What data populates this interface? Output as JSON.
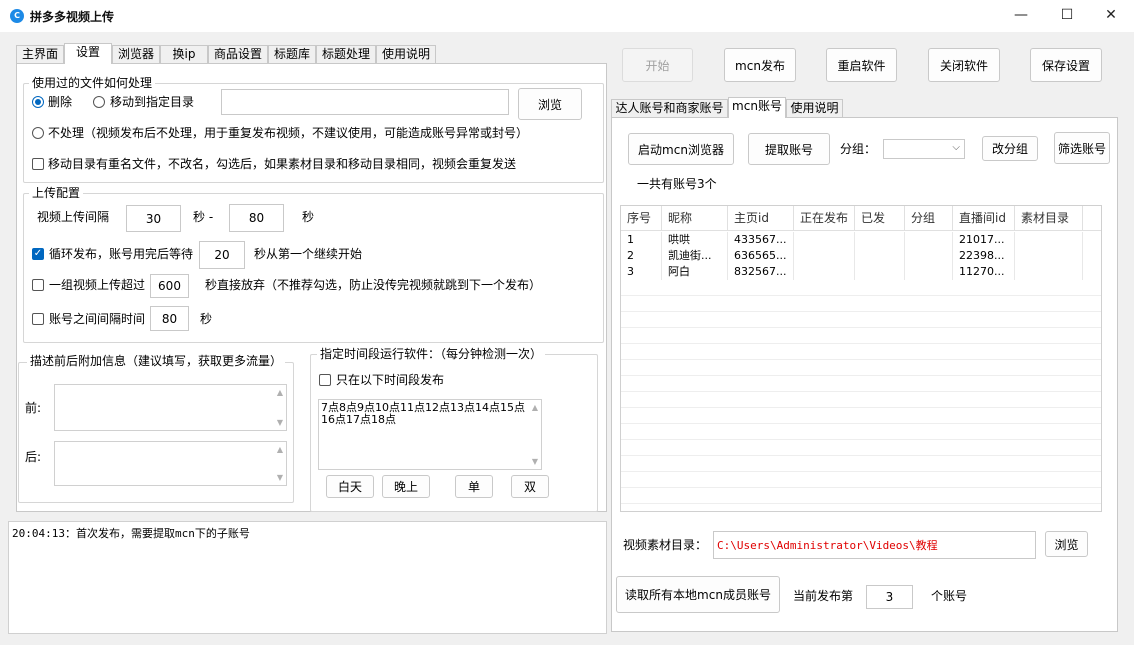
{
  "window": {
    "title": "拼多多视频上传",
    "minimize": "—",
    "maximize": "☐",
    "close": "✕"
  },
  "left_tabs": [
    "主界面",
    "设置",
    "浏览器",
    "换ip",
    "商品设置",
    "标题库",
    "标题处理",
    "使用说明"
  ],
  "file_handling": {
    "legend": "使用过的文件如何处理",
    "delete_label": "删除",
    "move_label": "移动到指定目录",
    "move_path": "",
    "browse_label": "浏览",
    "no_process_label": "不处理（视频发布后不处理，用于重复发布视频，不建议使用，可能造成账号异常或封号）",
    "rename_label": "移动目录有重名文件，不改名，勾选后，如果素材目录和移动目录相同，视频会重复发送"
  },
  "upload_config": {
    "legend": "上传配置",
    "interval_label": "视频上传间隔",
    "interval_min": "30",
    "sec_dash": "秒 -",
    "interval_max": "80",
    "sec": "秒",
    "loop_label": "循环发布，账号用完后等待",
    "loop_wait": "20",
    "loop_suffix": "秒从第一个继续开始",
    "group_label": "一组视频上传超过",
    "group_value": "600",
    "group_suffix": "秒直接放弃（不推荐勾选，防止没传完视频就跳到下一个发布）",
    "account_interval_label": "账号之间间隔时间",
    "account_interval_value": "80",
    "account_interval_suffix": "秒"
  },
  "desc_info": {
    "legend": "描述前后附加信息（建议填写，获取更多流量）",
    "before_label": "前:",
    "after_label": "后:",
    "before_value": "",
    "after_value": ""
  },
  "schedule": {
    "legend": "指定时间段运行软件：（每分钟检测一次）",
    "only_label": "只在以下时间段发布",
    "hours_text": "7点8点9点10点11点12点13点14点15点16点17点18点",
    "day_btn": "白天",
    "night_btn": "晚上",
    "odd_btn": "单",
    "even_btn": "双"
  },
  "log": {
    "text": "20:04:13：首次发布，需要提取mcn下的子账号"
  },
  "top_buttons": {
    "start": "开始",
    "mcn_publish": "mcn发布",
    "restart": "重启软件",
    "close_app": "关闭软件",
    "save": "保存设置"
  },
  "right_tabs": [
    "达人账号和商家账号",
    "mcn账号",
    "使用说明"
  ],
  "mcn": {
    "launch_browser": "启动mcn浏览器",
    "fetch_accounts": "提取账号",
    "group_label": "分组：",
    "group_value": "",
    "change_group": "改分组",
    "filter_accounts": "筛选账号",
    "count_text": "一共有账号3个"
  },
  "accounts_table": {
    "columns": [
      "序号",
      "昵称",
      "主页id",
      "正在发布",
      "已发",
      "分组",
      "直播间id",
      "素材目录"
    ],
    "rows": [
      [
        "1",
        "哄哄",
        "433567...",
        "",
        "",
        "",
        "21017...",
        ""
      ],
      [
        "2",
        "凯迪街...",
        "636565...",
        "",
        "",
        "",
        "22398...",
        ""
      ],
      [
        "3",
        "阿白",
        "832567...",
        "",
        "",
        "",
        "11270...",
        ""
      ]
    ]
  },
  "material": {
    "label": "视频素材目录：",
    "path": "C:\\Users\\Administrator\\Videos\\教程",
    "path_color": "#e00000",
    "browse": "浏览"
  },
  "bottom": {
    "read_local": "读取所有本地mcn成员账号",
    "current_label": "当前发布第",
    "current_value": "3",
    "current_suffix": "个账号"
  },
  "colors": {
    "accent": "#0067c0",
    "app_icon": "#1d8ae6"
  }
}
